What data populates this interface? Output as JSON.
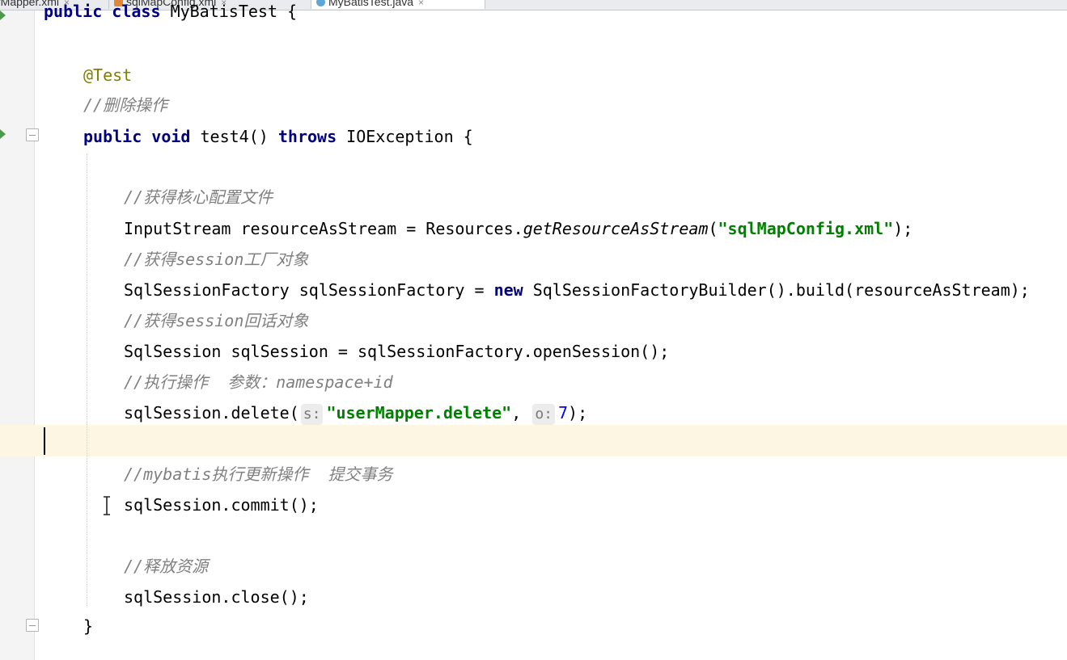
{
  "tabs": [
    {
      "label": "rMapper.xml",
      "close": "×",
      "active": false
    },
    {
      "label": "sqlMapConfig.xml",
      "close": "×",
      "active": false
    },
    {
      "label": "MyBatisTest.java",
      "close": "×",
      "active": true
    }
  ],
  "icons": [
    "run-arrow-icon",
    "fold-icon",
    "text-cursor-icon",
    "xml-file-icon",
    "java-class-icon"
  ],
  "colors": {
    "keyword": "#000080",
    "annotation": "#808000",
    "comment": "#808080",
    "string": "#008000",
    "number": "#0000ff",
    "current_line": "#fdf6e3"
  },
  "code": {
    "l0": {
      "kw1": "public",
      "kw2": "class",
      "name": "MyBatisTest {"
    },
    "l1": {
      "ann": "@Test"
    },
    "l2": {
      "cmt": "//删除操作"
    },
    "l3": {
      "kw1": "public",
      "kw2": "void",
      "mid": "test4()",
      "kw3": "throws",
      "rest": "IOException {"
    },
    "l4": {
      "cmt": "//获得核心配置文件"
    },
    "l5": {
      "a": "InputStream resourceAsStream = Resources.",
      "fn": "getResourceAsStream",
      "b": "(",
      "str": "\"sqlMapConfig.xml\"",
      "c": ");"
    },
    "l6": {
      "cmt": "//获得session工厂对象"
    },
    "l7": {
      "a": "SqlSessionFactory sqlSessionFactory = ",
      "kw": "new",
      "b": " SqlSessionFactoryBuilder().build(resourceAsStream);"
    },
    "l8": {
      "cmt": "//获得session回话对象"
    },
    "l9": {
      "a": "SqlSession sqlSession = sqlSessionFactory.openSession();"
    },
    "l10": {
      "cmt": "//执行操作  参数：namespace+id"
    },
    "l11": {
      "a": "sqlSession.delete(",
      "hint1": "s:",
      "str": "\"userMapper.delete\"",
      "b": ", ",
      "hint2": "o:",
      "num": "7",
      "c": ");"
    },
    "l12": {
      "cmt": "//mybatis执行更新操作  提交事务"
    },
    "l13": {
      "a": "sqlSession.commit();"
    },
    "l14": {
      "cmt": "//释放资源"
    },
    "l15": {
      "a": "sqlSession.close();"
    },
    "l16": {
      "a": "}"
    }
  }
}
